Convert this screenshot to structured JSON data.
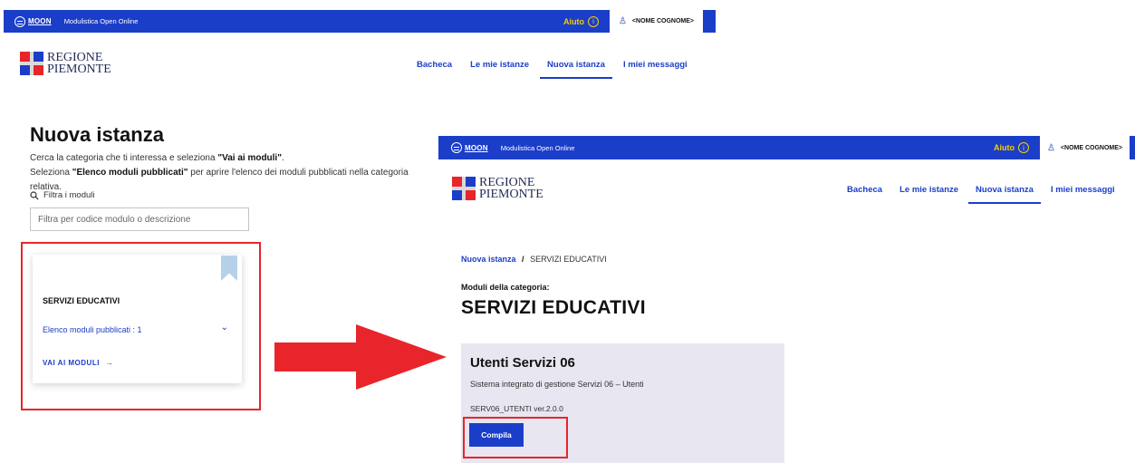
{
  "left": {
    "header": {
      "logo_text": "MOON",
      "app_title": "Modulistica Open Online",
      "help_label": "Aiuto",
      "help_icon": "info-icon",
      "user_icon": "user-icon",
      "user_name": "<NOME COGNOME>"
    },
    "brand": {
      "line1": "REGIONE",
      "line2": "PIEMONTE"
    },
    "nav": [
      {
        "label": "Bacheca",
        "active": false
      },
      {
        "label": "Le mie istanze",
        "active": false
      },
      {
        "label": "Nuova istanza",
        "active": true
      },
      {
        "label": "I miei messaggi",
        "active": false
      }
    ],
    "page_title": "Nuova istanza",
    "desc_line1_pre": "Cerca la categoria che ti interessa e seleziona ",
    "desc_line1_bold": "\"Vai ai moduli\"",
    "desc_line1_post": ".",
    "desc_line2_pre": "Seleziona ",
    "desc_line2_bold": "\"Elenco moduli pubblicati\"",
    "desc_line2_post": " per aprire l'elenco dei moduli pubblicati nella categoria relativa.",
    "filter_label": "Filtra i moduli",
    "search_placeholder": "Filtra per codice modulo o descrizione",
    "card": {
      "title": "SERVIZI EDUCATIVI",
      "list_link": "Elenco moduli pubblicati : 1",
      "action": "VAI AI MODULI",
      "action_arrow": "→",
      "chevron": "⌄"
    }
  },
  "right": {
    "header": {
      "logo_text": "MOON",
      "app_title": "Modulistica Open Online",
      "help_label": "Aiuto",
      "user_name": "<NOME COGNOME>"
    },
    "brand": {
      "line1": "REGIONE",
      "line2": "PIEMONTE"
    },
    "nav": [
      {
        "label": "Bacheca",
        "active": false
      },
      {
        "label": "Le mie istanze",
        "active": false
      },
      {
        "label": "Nuova istanza",
        "active": true
      },
      {
        "label": "I miei messaggi",
        "active": false
      }
    ],
    "breadcrumb": {
      "link": "Nuova istanza",
      "sep": "/",
      "current": "SERVIZI EDUCATIVI"
    },
    "sub_label": "Moduli della categoria:",
    "category_title": "SERVIZI EDUCATIVI",
    "module": {
      "title": "Utenti Servizi 06",
      "description": "Sistema integrato di gestione Servizi 06 – Utenti",
      "version": "SERV06_UTENTI ver.2.0.0",
      "button": "Compila"
    }
  },
  "colors": {
    "brand_blue": "#1b3ec9",
    "highlight_red": "#e8252a",
    "help_yellow": "#f5d000",
    "card_lavender": "#e7e6f1"
  }
}
